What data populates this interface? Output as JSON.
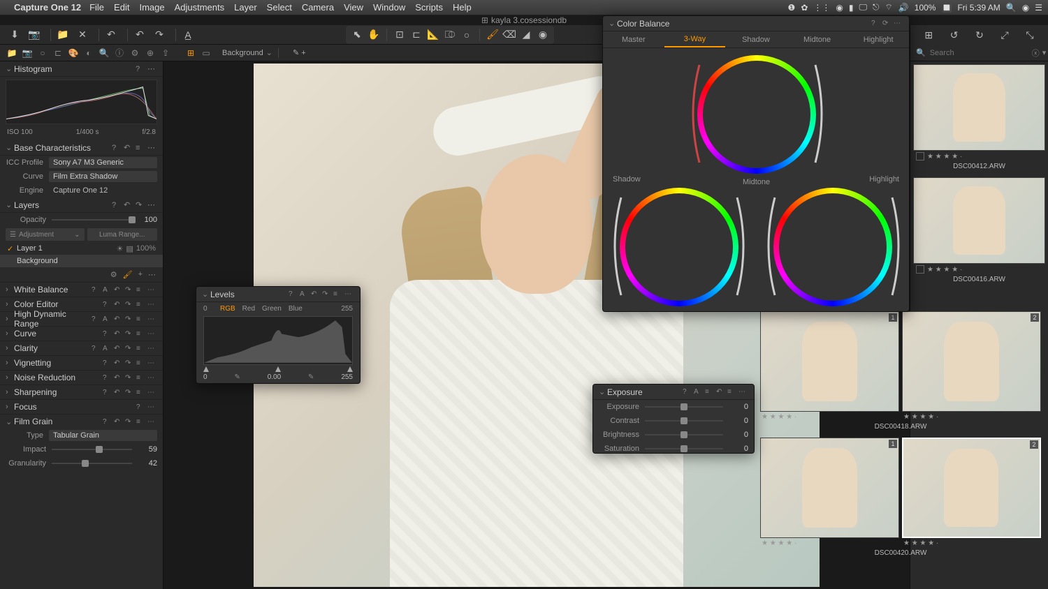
{
  "menubar": {
    "app": "Capture One 12",
    "items": [
      "File",
      "Edit",
      "Image",
      "Adjustments",
      "Layer",
      "Select",
      "Camera",
      "View",
      "Window",
      "Scripts",
      "Help"
    ],
    "battery": "100%",
    "clock": "Fri 5:39 AM"
  },
  "doc_title": "kayla 3.cosessiondb",
  "bg_label": "Background",
  "search_placeholder": "Search",
  "left": {
    "histogram": {
      "title": "Histogram",
      "iso": "ISO 100",
      "shutter": "1/400 s",
      "aperture": "f/2.8"
    },
    "base": {
      "title": "Base Characteristics",
      "icc_label": "ICC Profile",
      "icc": "Sony A7 M3 Generic",
      "curve_label": "Curve",
      "curve": "Film Extra Shadow",
      "engine_label": "Engine",
      "engine": "Capture One 12"
    },
    "layers": {
      "title": "Layers",
      "opacity_label": "Opacity",
      "opacity": "100",
      "adj": "Adjustment",
      "luma": "Luma Range...",
      "layer1": "Layer 1",
      "layer1_pct": "100%",
      "bg": "Background"
    },
    "sections": [
      "White Balance",
      "Color Editor",
      "High Dynamic Range",
      "Curve",
      "Clarity",
      "Vignetting",
      "Noise Reduction",
      "Sharpening",
      "Focus"
    ],
    "grain": {
      "title": "Film Grain",
      "type_label": "Type",
      "type": "Tabular Grain",
      "impact_label": "Impact",
      "impact": "59",
      "gran_label": "Granularity",
      "gran": "42"
    }
  },
  "color_balance": {
    "title": "Color Balance",
    "tabs": [
      "Master",
      "3-Way",
      "Shadow",
      "Midtone",
      "Highlight"
    ],
    "active": 1,
    "labels": {
      "shadow": "Shadow",
      "midtone": "Midtone",
      "highlight": "Highlight"
    }
  },
  "levels": {
    "title": "Levels",
    "channels": [
      "RGB",
      "Red",
      "Green",
      "Blue"
    ],
    "active": 0,
    "in_low": "0",
    "in_high": "255",
    "out_low": "0",
    "out_mid": "0.00",
    "out_high": "255"
  },
  "exposure": {
    "title": "Exposure",
    "rows": [
      {
        "label": "Exposure",
        "val": "0"
      },
      {
        "label": "Contrast",
        "val": "0"
      },
      {
        "label": "Brightness",
        "val": "0"
      },
      {
        "label": "Saturation",
        "val": "0"
      }
    ]
  },
  "thumbs": {
    "items": [
      {
        "name": "DSC00412.ARW",
        "stars": "★ ★ ★ ★ ·"
      },
      {
        "name": "DSC00416.ARW",
        "stars": "★ ★ ★ ★ ·"
      }
    ],
    "pairs": [
      {
        "name": "DSC00418.ARW",
        "b1": "1",
        "b2": "2",
        "stars": "★ ★ ★ ★ ·"
      },
      {
        "name": "DSC00420.ARW",
        "b1": "1",
        "b2": "2",
        "stars": "★ ★ ★ ★ ·",
        "sel": true
      }
    ]
  }
}
